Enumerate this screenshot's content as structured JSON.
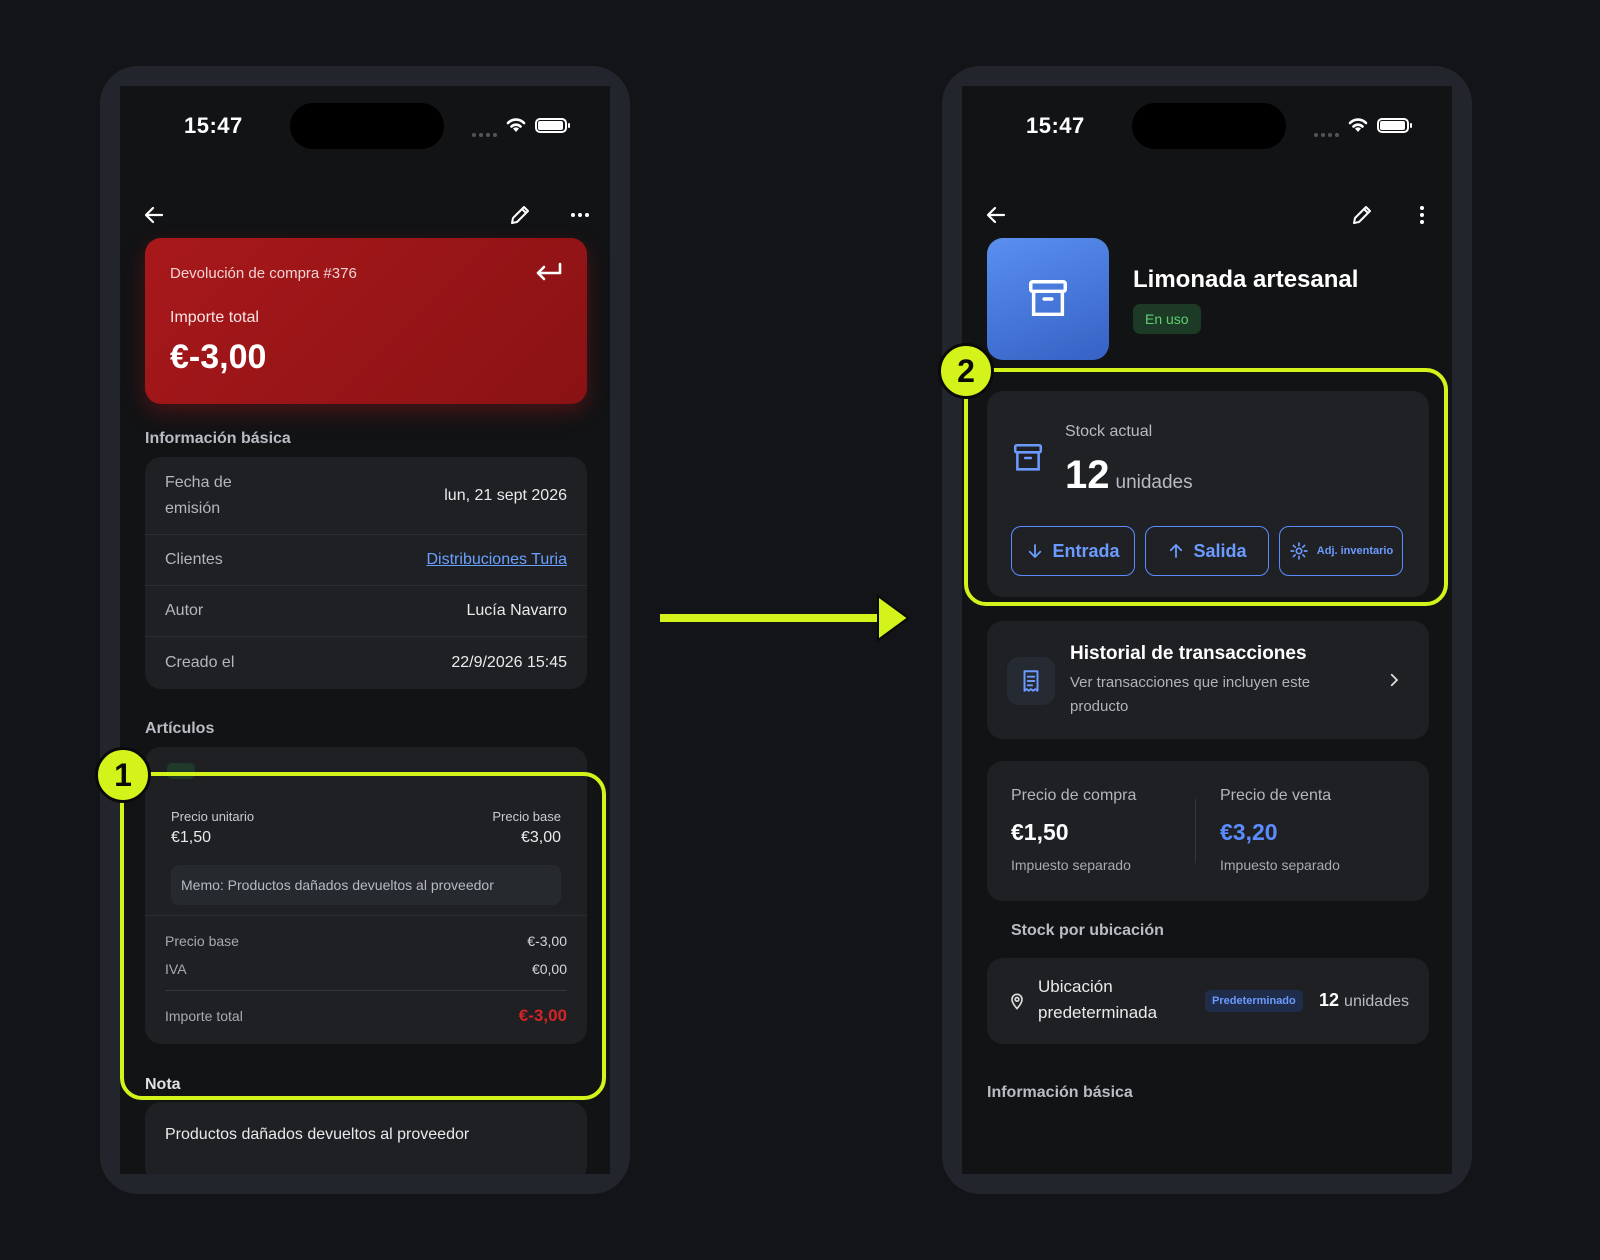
{
  "colors": {
    "accent": "#d4f31a",
    "danger": "#a8181b",
    "link": "#6aa0ff",
    "success": "#5fcf73"
  },
  "left_phone": {
    "status_time": "15:47",
    "receipt": {
      "title": "Devolución de compra #376",
      "amount_label": "Importe total",
      "amount": "€-3,00"
    },
    "basic_info_title": "Información básica",
    "basic_info": [
      {
        "label": "Fecha de emisión",
        "value": "lun, 21 sept 2026"
      },
      {
        "label": "Clientes",
        "value": "Distribuciones Turia"
      },
      {
        "label": "Autor",
        "value": "Lucía Navarro"
      },
      {
        "label": "Creado el",
        "value": "22/9/2026 15:45"
      }
    ],
    "articles_title": "Artículos",
    "article": {
      "unit_price_label": "Precio unitario",
      "unit_price": "€1,50",
      "base_price_label": "Precio base",
      "base_price": "€3,00",
      "memo": "Memo: Productos dañados devueltos al proveedor"
    },
    "totals": [
      {
        "label": "Precio base",
        "value": "€-3,00"
      },
      {
        "label": "IVA",
        "value": "€0,00"
      },
      {
        "label": "Importe total",
        "value": "€-3,00"
      }
    ],
    "note_title": "Nota",
    "note_text": "Productos dañados devueltos al proveedor",
    "highlight_number": "1"
  },
  "right_phone": {
    "status_time": "15:47",
    "product_name": "Limonada artesanal",
    "status_badge": "En uso",
    "stock_label": "Stock actual",
    "stock_value": "12",
    "stock_unit": "unidades",
    "buttons": {
      "entry": "Entrada",
      "exit": "Salida",
      "adjust": "Adj. inventario"
    },
    "history_title": "Historial de transacciones",
    "history_subtitle": "Ver transacciones que incluyen este producto",
    "purchase_label": "Precio de compra",
    "purchase_value": "€1,50",
    "purchase_tax": "Impuesto separado",
    "sale_label": "Precio de venta",
    "sale_value": "€3,20",
    "sale_tax": "Impuesto separado",
    "stock_by_location_title": "Stock por ubicación",
    "location_name": "Ubicación predeterminada",
    "location_badge": "Predeterminado",
    "location_qty": "12",
    "location_unit": "unidades",
    "basic_info_title": "Información básica",
    "highlight_number": "2"
  }
}
